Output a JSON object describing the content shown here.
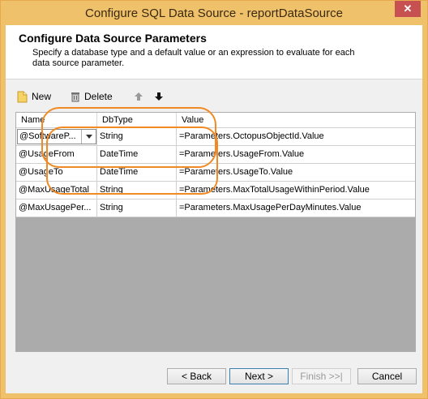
{
  "window": {
    "title": "Configure SQL Data Source - reportDataSource",
    "close_label": "✕"
  },
  "header": {
    "heading": "Configure Data Source Parameters",
    "description": "Specify a database type and a default value or an expression to evaluate for each data source parameter."
  },
  "toolbar": {
    "new_label": "New",
    "delete_label": "Delete"
  },
  "grid": {
    "columns": [
      "Name",
      "DbType",
      "Value"
    ],
    "rows": [
      {
        "name": "@SoftwareP...",
        "dbtype": "String",
        "value": "=Parameters.OctopusObjectId.Value"
      },
      {
        "name": "@UsageFrom",
        "dbtype": "DateTime",
        "value": "=Parameters.UsageFrom.Value"
      },
      {
        "name": "@UsageTo",
        "dbtype": "DateTime",
        "value": "=Parameters.UsageTo.Value"
      },
      {
        "name": "@MaxUsageTotal",
        "dbtype": "String",
        "value": "=Parameters.MaxTotalUsageWithinPeriod.Value"
      },
      {
        "name": "@MaxUsagePer...",
        "dbtype": "String",
        "value": "=Parameters.MaxUsagePerDayMinutes.Value"
      }
    ]
  },
  "footer": {
    "back_label": "< Back",
    "next_label": "Next >",
    "finish_label": "Finish >>|",
    "cancel_label": "Cancel"
  },
  "colors": {
    "titlebar": "#f0c16b",
    "highlight": "#f08a24",
    "grid_empty": "#ababab"
  }
}
